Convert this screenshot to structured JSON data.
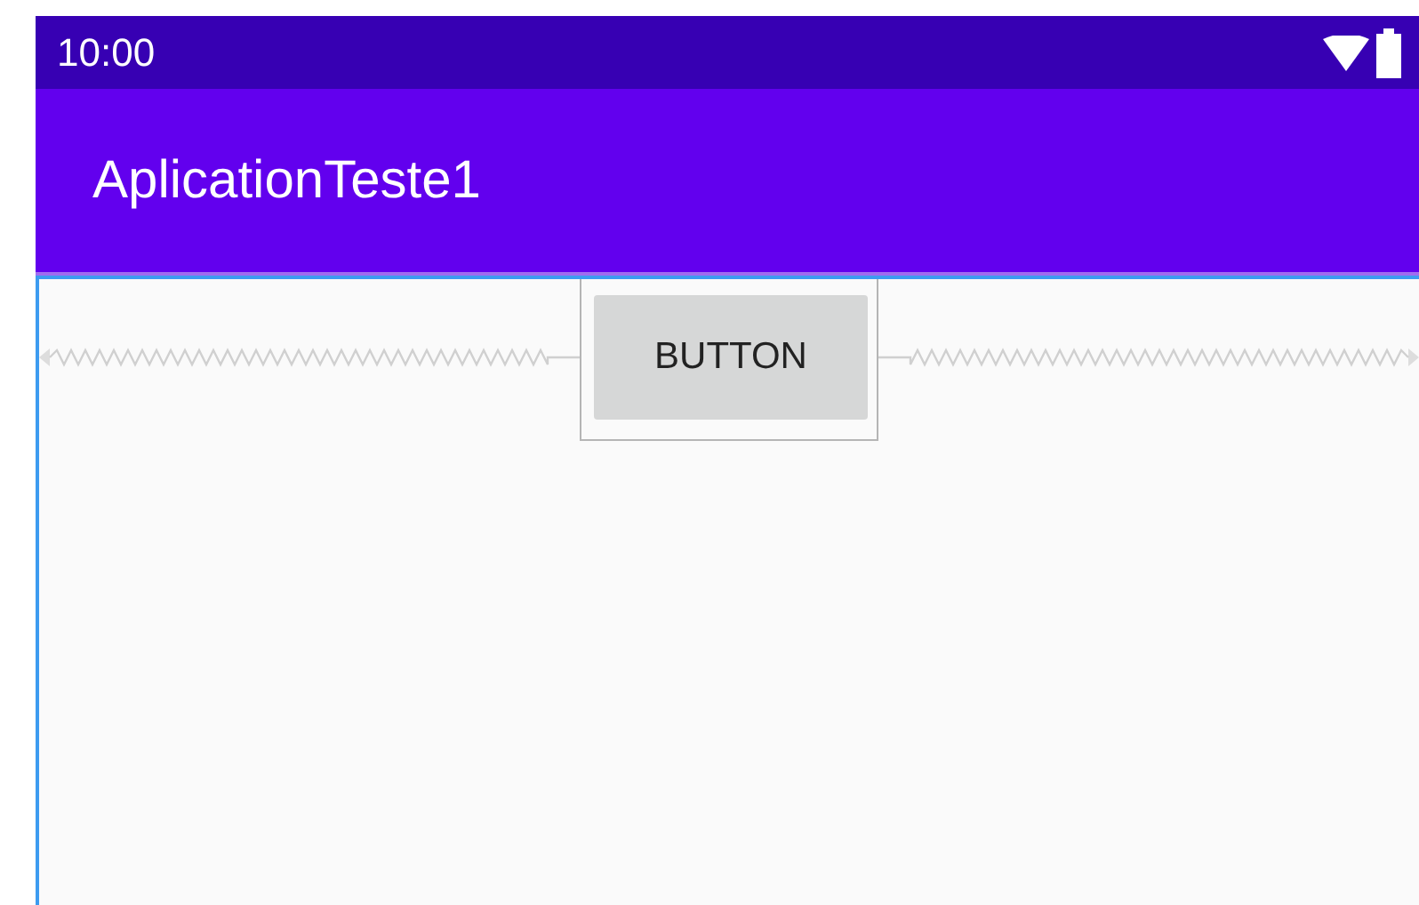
{
  "status_bar": {
    "time": "10:00"
  },
  "app_bar": {
    "title": "AplicationTeste1"
  },
  "button": {
    "label": "BUTTON",
    "selected": true
  }
}
